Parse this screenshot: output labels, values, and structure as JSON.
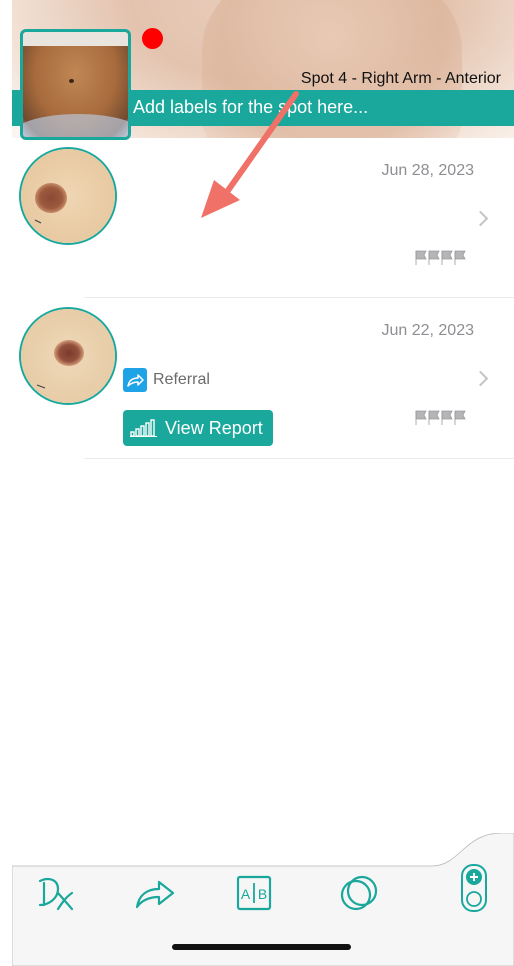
{
  "header": {
    "spot_title": "Spot 4 - Right Arm - Anterior",
    "labels_placeholder": "Add labels for the spot here..."
  },
  "colors": {
    "accent": "#1aa79c",
    "marker": "#ff0000",
    "annotation_arrow": "#f07167",
    "referral": "#1ea3e6"
  },
  "entries": [
    {
      "date": "Jun 28, 2023",
      "flags_icon": "four-flags-icon"
    },
    {
      "date": "Jun 22, 2023",
      "referral_label": "Referral",
      "view_report_label": "View Report",
      "flags_icon": "four-flags-icon"
    }
  ],
  "tabbar": {
    "items": [
      "dx-icon",
      "share-arrow-icon",
      "ab-compare-icon",
      "overlap-circles-icon",
      "add-device-icon"
    ]
  }
}
